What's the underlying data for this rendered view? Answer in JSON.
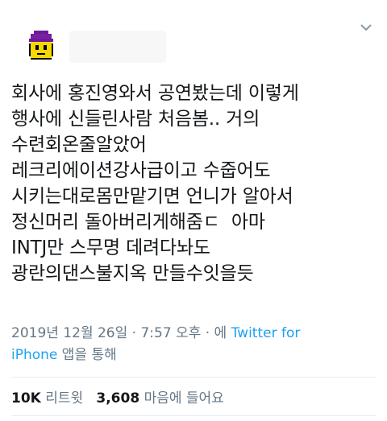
{
  "tweet": {
    "lines": [
      "회사에 홍진영와서 공연봤는데 이렇게",
      "행사에 신들린사람 처음봄.. 거의",
      "수련회온줄알았어",
      "레크리에이션강사급이고 수줍어도",
      "시키는대로몸만맡기면 언니가 알아서",
      "정신머리 돌아버리게해줌ㄷ  아마",
      "INTJ만 스무명 데려다놔도",
      "광란의댄스불지옥 만들수잇을듯"
    ]
  },
  "meta": {
    "datetime": "2019년 12월 26일 · 7:57 오후 · 에 ",
    "source_link_1": "Twitter for",
    "source_link_2": "iPhone",
    "source_suffix": " 앱을 통해"
  },
  "stats": {
    "retweets_count": "10K",
    "retweets_label": "리트윗",
    "likes_count": "3,608",
    "likes_label": "마음에 들어요"
  },
  "icons": {
    "avatar": "pixel-face-avatar",
    "menu": "chevron-down-icon"
  },
  "colors": {
    "accent": "#1da1f2",
    "secondary_text": "#657786",
    "primary_text": "#14171a"
  }
}
